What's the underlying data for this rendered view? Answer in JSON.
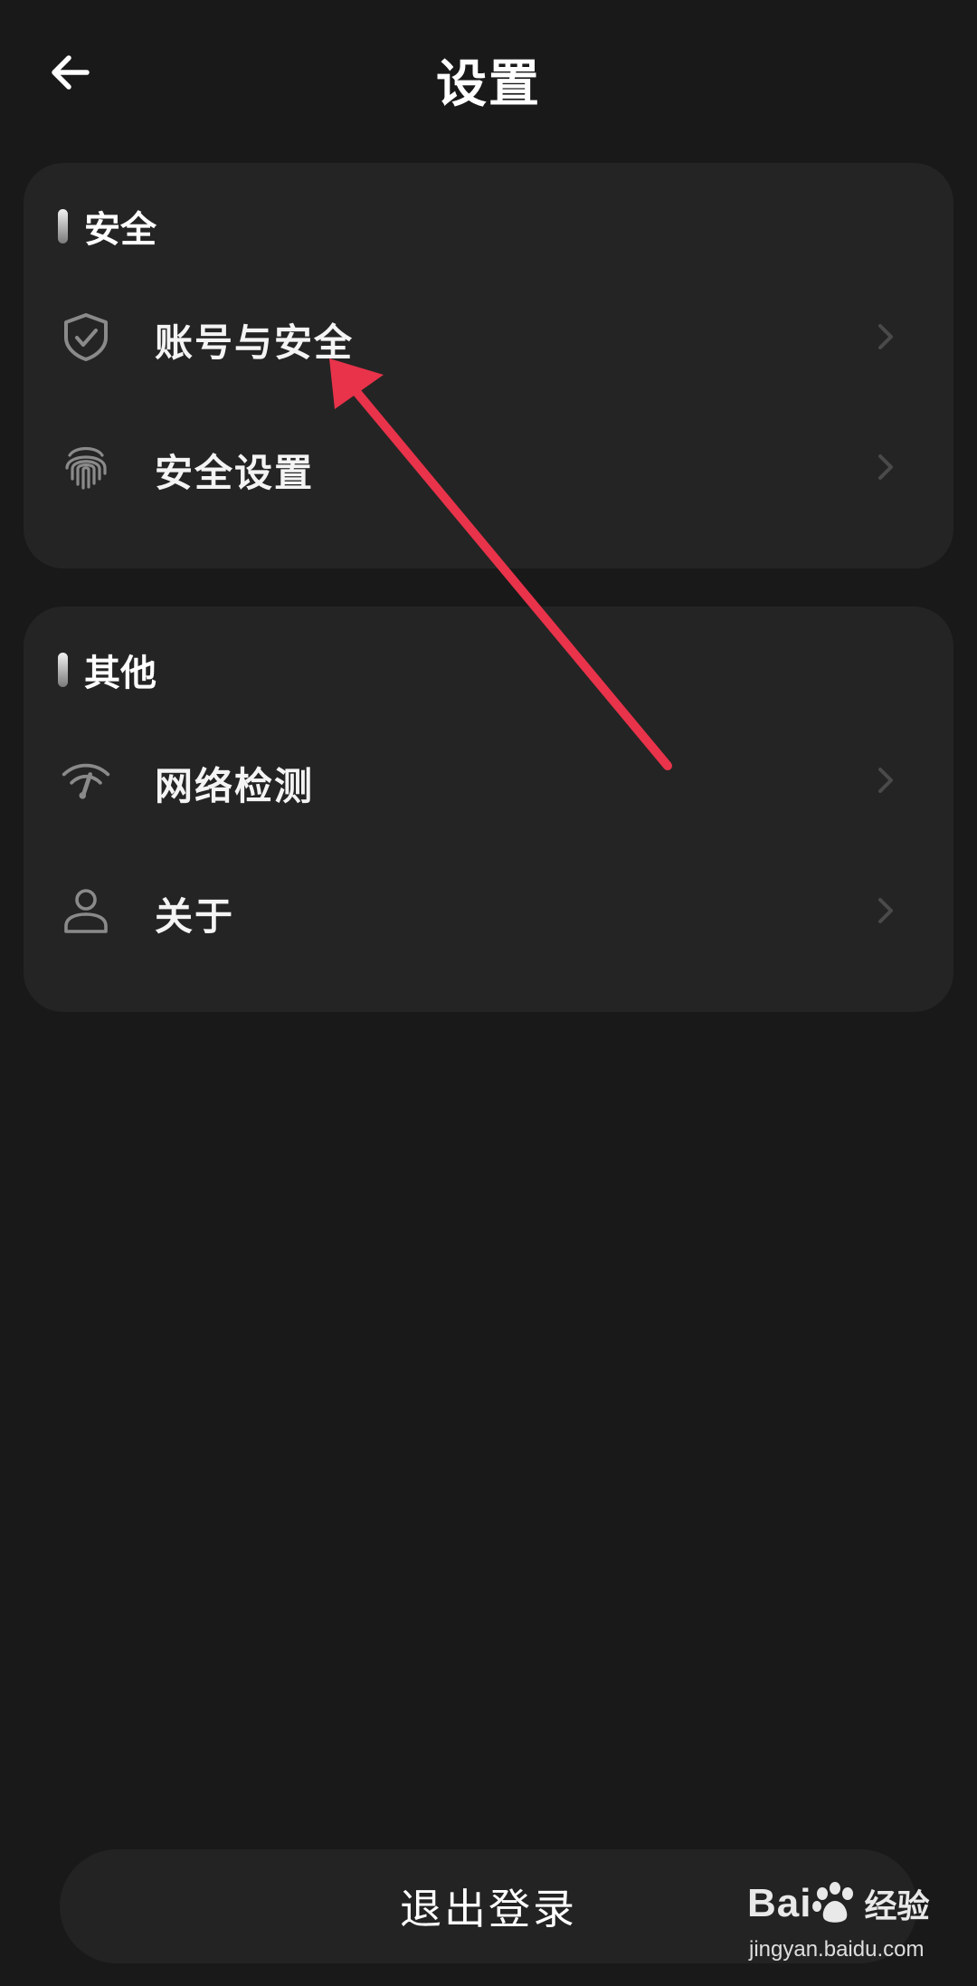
{
  "header": {
    "title": "设置"
  },
  "sections": [
    {
      "title": "安全",
      "items": [
        {
          "label": "账号与安全",
          "icon": "shield-check-icon"
        },
        {
          "label": "安全设置",
          "icon": "fingerprint-icon"
        }
      ]
    },
    {
      "title": "其他",
      "items": [
        {
          "label": "网络检测",
          "icon": "wifi-check-icon"
        },
        {
          "label": "关于",
          "icon": "person-icon"
        }
      ]
    }
  ],
  "logout": {
    "label": "退出登录"
  },
  "watermark": {
    "brand_prefix": "Bai",
    "brand_suffix": "经验",
    "url": "jingyan.baidu.com"
  },
  "colors": {
    "background": "#191919",
    "card": "#242424",
    "arrow": "#e8334a"
  }
}
